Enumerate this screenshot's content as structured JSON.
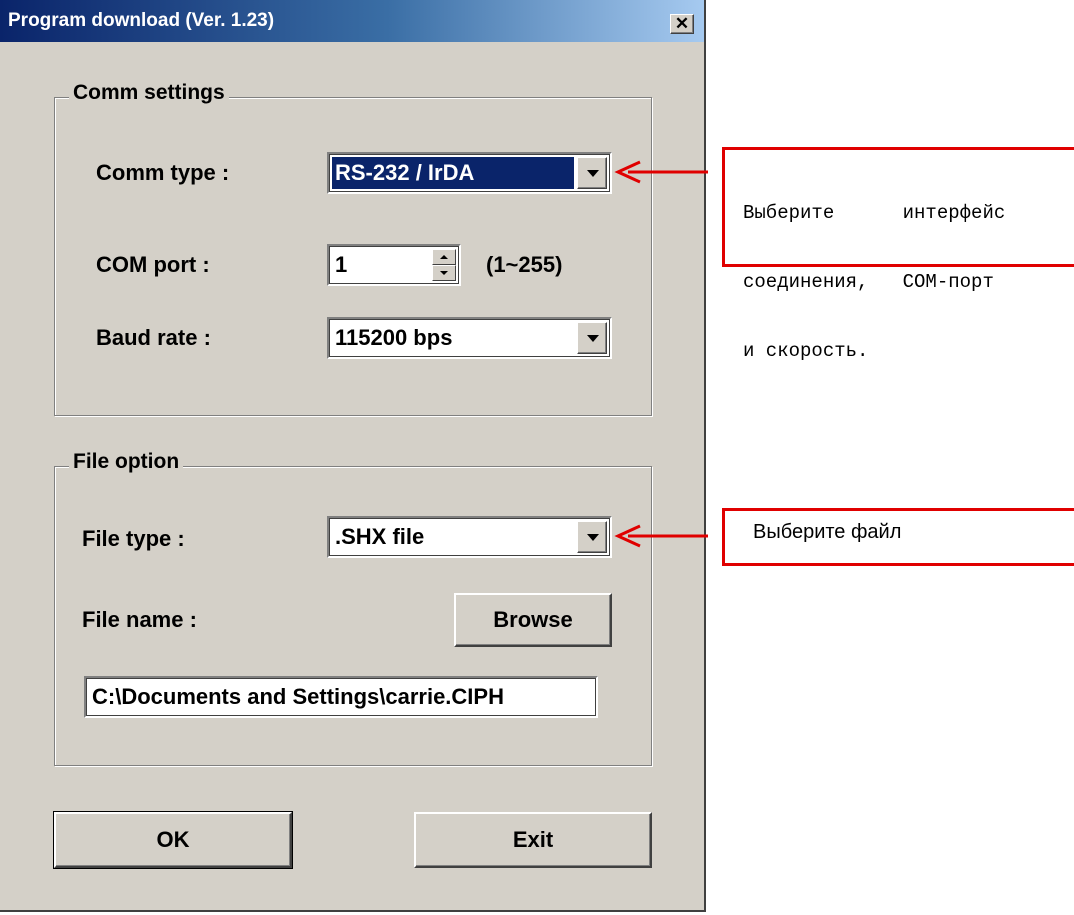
{
  "window": {
    "title": "Program download  (Ver. 1.23)",
    "close_glyph": "✕"
  },
  "comm": {
    "legend": "Comm settings",
    "type_label": "Comm type :",
    "type_value": "RS-232 / IrDA",
    "port_label": "COM port :",
    "port_value": "1",
    "port_range": "(1~255)",
    "baud_label": "Baud rate :",
    "baud_value": "115200 bps"
  },
  "file": {
    "legend": "File option",
    "type_label": "File type :",
    "type_value": ".SHX file",
    "name_label": "File name :",
    "browse_label": "Browse",
    "path_value": "C:\\Documents and Settings\\carrie.CIPH"
  },
  "buttons": {
    "ok": "OK",
    "exit": "Exit"
  },
  "annotations": {
    "comm_note_line1": "Выберите      интерфейс",
    "comm_note_line2": "соединения,   СОМ-порт",
    "comm_note_line3": "и скорость.",
    "file_note": "Выберите файл",
    "color": "#e00000"
  }
}
